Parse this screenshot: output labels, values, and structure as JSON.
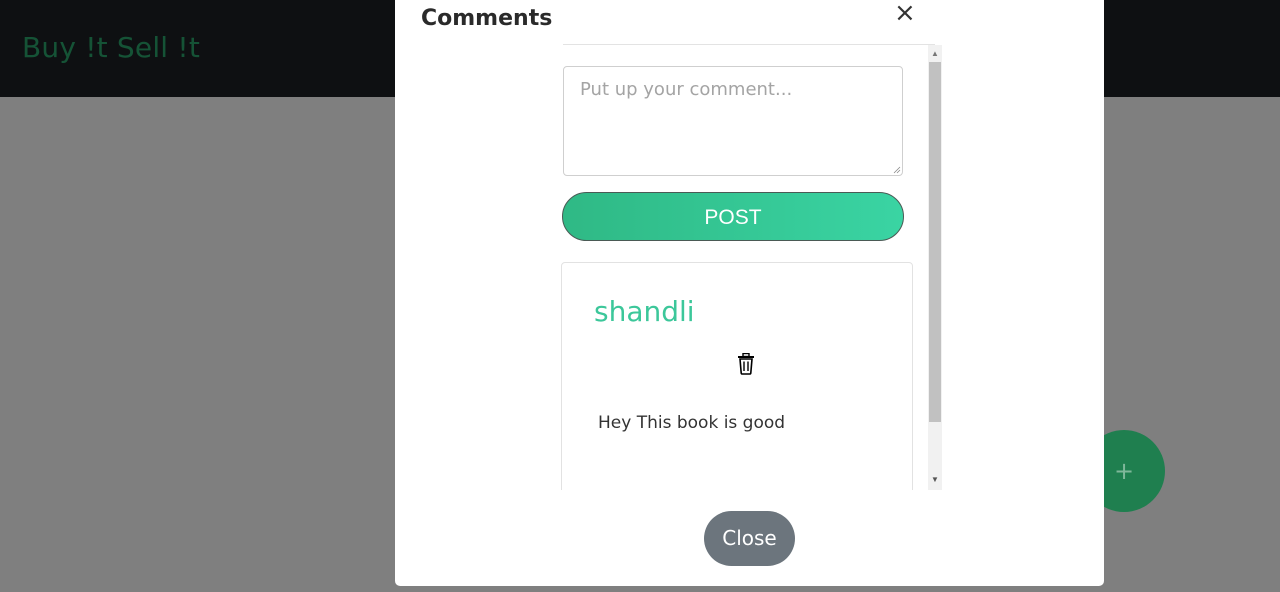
{
  "navbar": {
    "brand": "Buy !t Sell !t"
  },
  "fab": {
    "label": "+"
  },
  "modal": {
    "title": "Comments",
    "close_symbol": "×",
    "comment_input": {
      "placeholder": "Put up your comment...",
      "value": ""
    },
    "post_label": "POST",
    "comments": [
      {
        "author": "shandli",
        "text": "Hey This book is good",
        "delete_icon": "trash-icon"
      }
    ],
    "close_label": "Close"
  },
  "colors": {
    "navbar_bg": "#1d2124",
    "brand": "#2aa66c",
    "post_gradient_start": "#2fb985",
    "post_gradient_end": "#3ad4a3",
    "author": "#3cc79a",
    "close_button": "#6c757d",
    "fab": "#1f7f4f"
  }
}
